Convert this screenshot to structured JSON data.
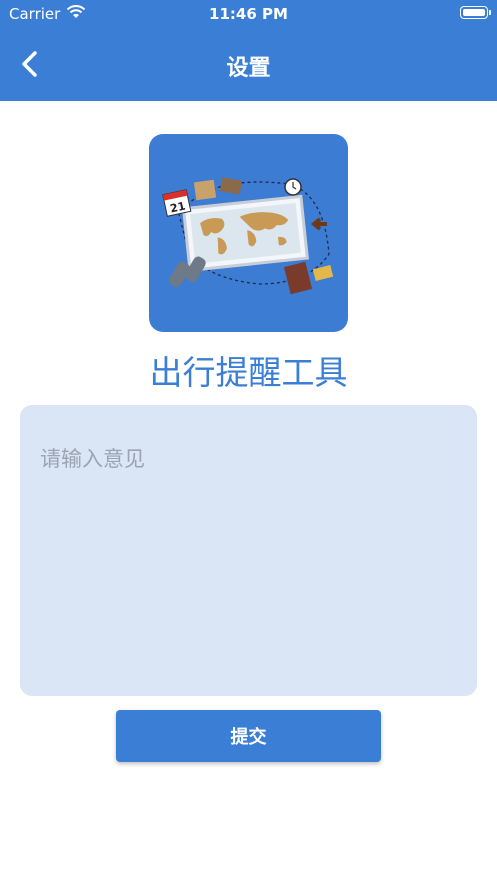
{
  "status_bar": {
    "carrier": "Carrier",
    "time": "11:46 PM"
  },
  "nav": {
    "title": "设置",
    "back_icon": "chevron-left-icon"
  },
  "app": {
    "name": "出行提醒工具",
    "logo_calendar_day": "21"
  },
  "feedback": {
    "placeholder": "请输入意见",
    "value": ""
  },
  "submit": {
    "label": "提交"
  },
  "colors": {
    "primary": "#3a7fd5",
    "input_bg": "#dae6f6",
    "placeholder": "#9ba4b0"
  }
}
